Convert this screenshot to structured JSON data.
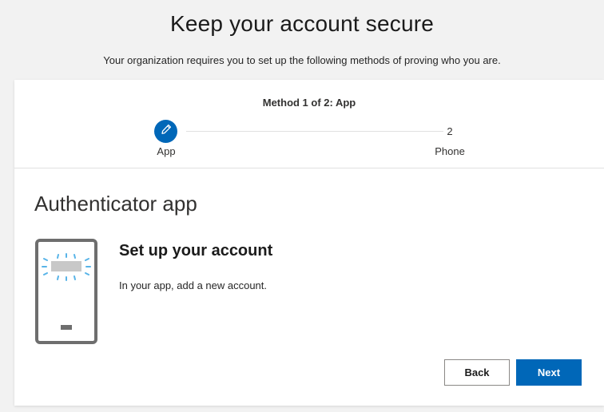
{
  "header": {
    "title": "Keep your account secure",
    "subtitle": "Your organization requires you to set up the following methods of proving who you are."
  },
  "progress": {
    "method_label": "Method 1 of 2: App",
    "current_step": 1,
    "total_steps": 2,
    "steps": [
      {
        "icon": "pencil-icon",
        "label": "App"
      },
      {
        "number": "2",
        "label": "Phone"
      }
    ]
  },
  "main": {
    "section_title": "Authenticator app",
    "illustration_icon": "phone-icon",
    "setup_heading": "Set up your account",
    "setup_description": "In your app, add a new account."
  },
  "actions": {
    "back_label": "Back",
    "next_label": "Next"
  },
  "colors": {
    "accent": "#0067b8",
    "page_background": "#f2f2f2",
    "card_background": "#ffffff",
    "phone_outline": "#6e6e6e",
    "glow": "#58b4e8"
  }
}
